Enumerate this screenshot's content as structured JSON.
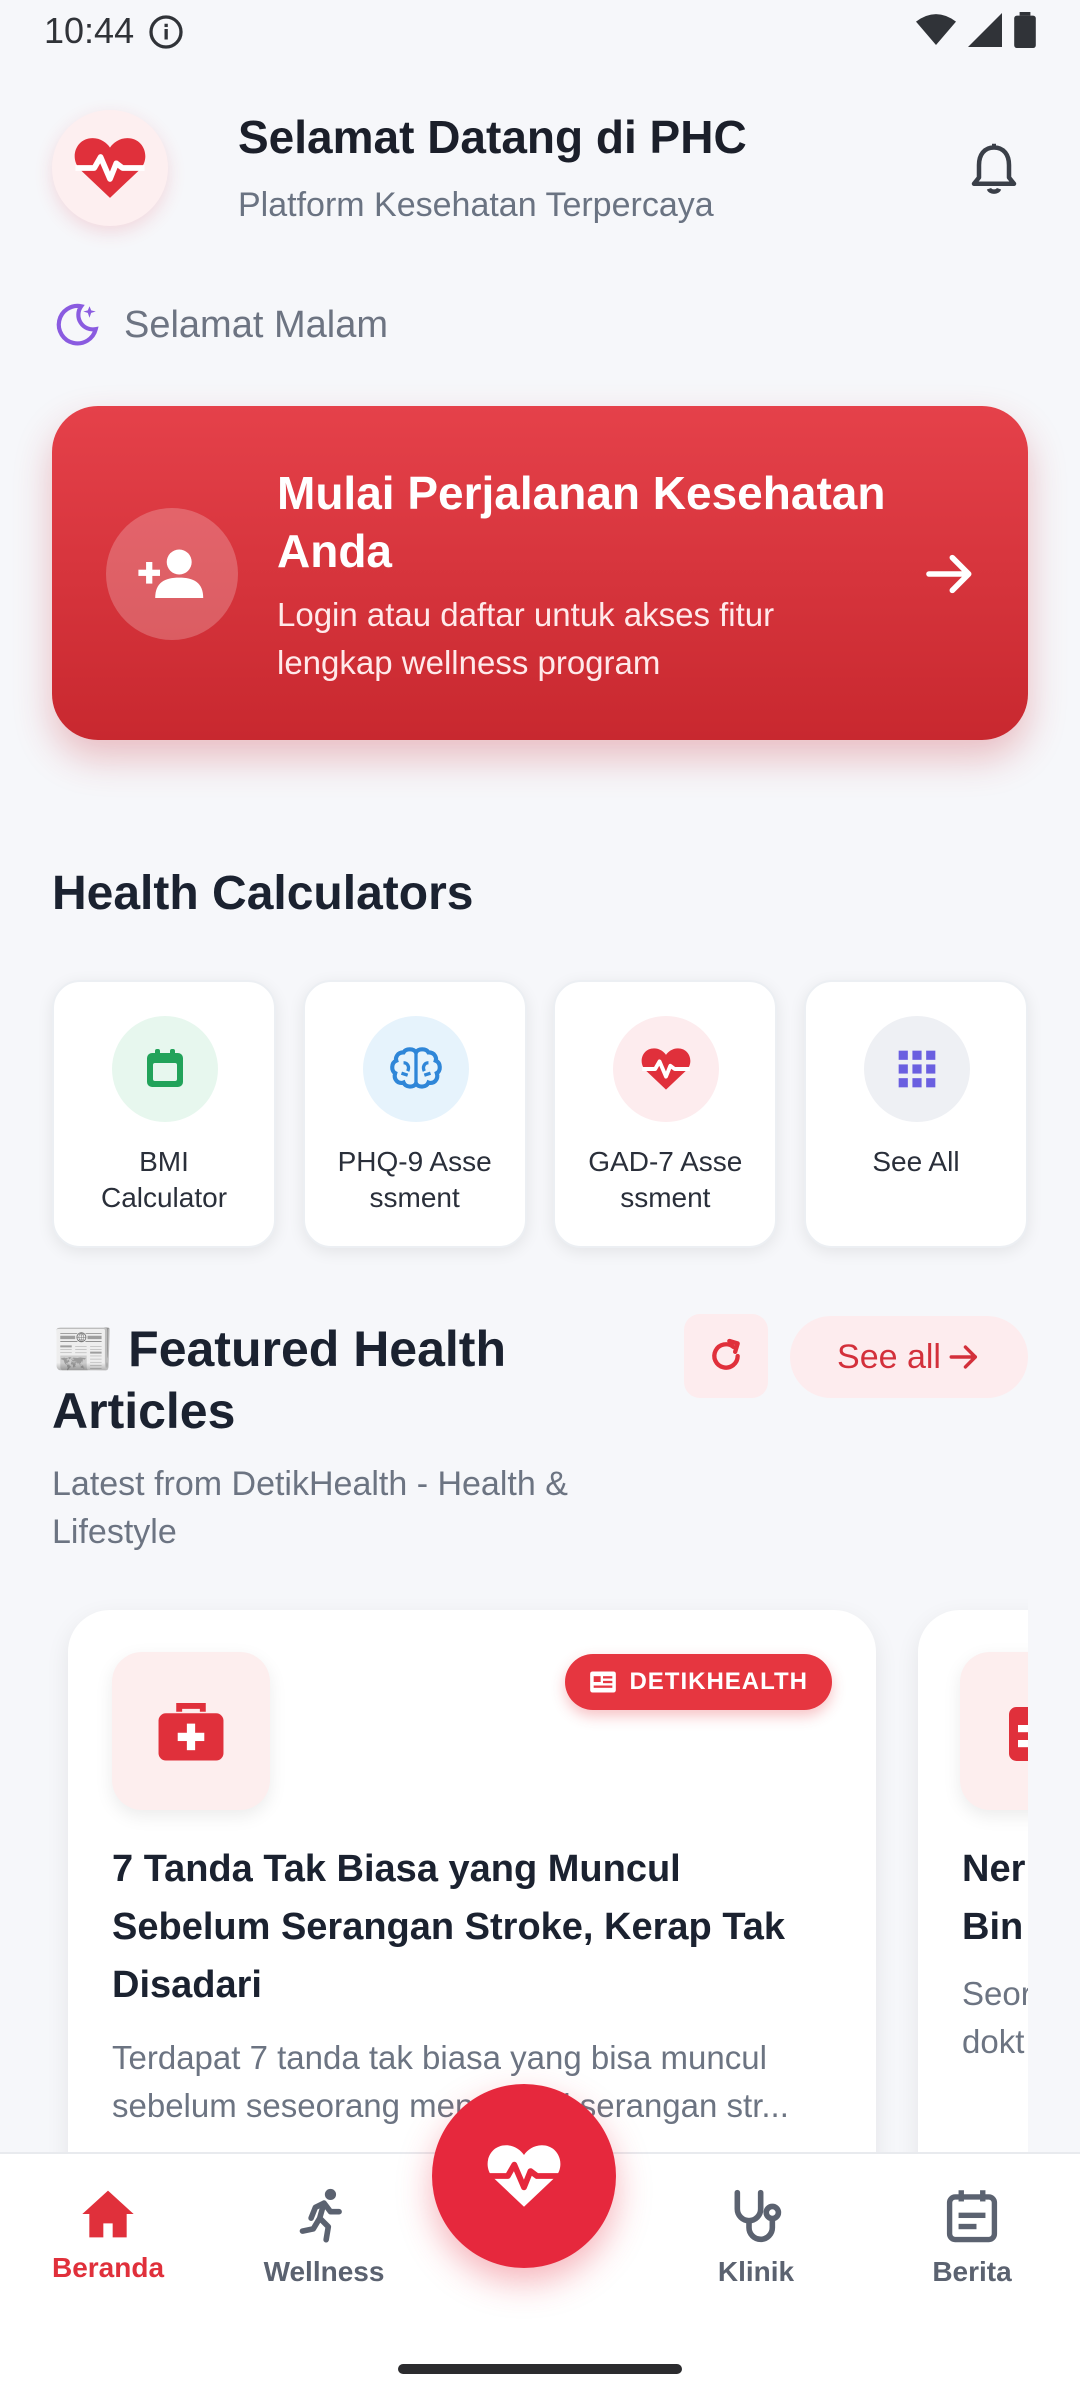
{
  "status_bar": {
    "time": "10:44"
  },
  "header": {
    "title": "Selamat Datang di PHC",
    "subtitle": "Platform Kesehatan Terpercaya"
  },
  "greeting": "Selamat Malam",
  "banner": {
    "title": "Mulai Perjalanan Kesehatan Anda",
    "subtitle": "Login atau daftar untuk akses fitur lengkap wellness program"
  },
  "calculators": {
    "title": "Health Calculators",
    "items": [
      {
        "label": "BMI Calculator",
        "icon": "bmi-calendar-icon",
        "bg": "#e7f7ee",
        "color": "#22a35a"
      },
      {
        "label": "PHQ-9 Assessment",
        "icon": "brain-icon",
        "bg": "#e6f3fc",
        "color": "#2f86d8"
      },
      {
        "label": "GAD-7 Assessment",
        "icon": "heart-pulse-icon",
        "bg": "#fdecee",
        "color": "#e0303b"
      },
      {
        "label": "See All",
        "icon": "grid-icon",
        "bg": "#eef0f4",
        "color": "#6a5fe0"
      }
    ]
  },
  "featured": {
    "title": "📰 Featured Health Articles",
    "subtitle": "Latest from DetikHealth - Health & Lifestyle",
    "see_all": "See all"
  },
  "articles": [
    {
      "source": "DETIKHEALTH",
      "title": "7 Tanda Tak Biasa yang Muncul Sebelum Serangan Stroke, Kerap Tak Disadari",
      "description_line1": "Terdapat 7 tanda tak biasa yang bisa muncul",
      "description_line2": "sebelum seseorang mengalami serangan str..."
    },
    {
      "title": "Ner Bin",
      "description": "Seor dokt"
    }
  ],
  "nav": {
    "items": [
      {
        "label": "Beranda",
        "active": true
      },
      {
        "label": "Wellness",
        "active": false
      },
      {
        "label": "Klinik",
        "active": false
      },
      {
        "label": "Berita",
        "active": false
      }
    ]
  },
  "colors": {
    "primary": "#e0303b",
    "banner": "#d6343c"
  }
}
